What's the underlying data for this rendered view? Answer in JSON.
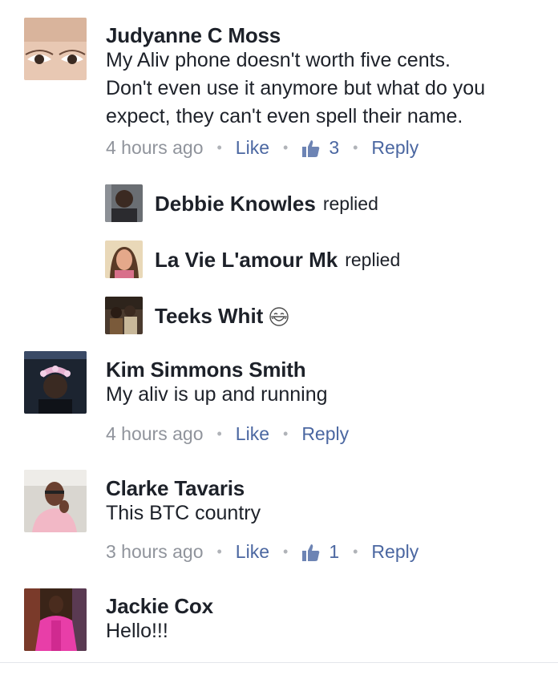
{
  "comments": [
    {
      "author": "Judyanne C Moss",
      "lines": [
        "My Aliv phone doesn't worth five cents.",
        "Don't even use it anymore but what do you",
        "expect, they can't even spell their name."
      ],
      "time": "4 hours ago",
      "like_label": "Like",
      "like_count": "3",
      "reply_label": "Reply",
      "replies": [
        {
          "name": "Debbie Knowles",
          "suffix": "replied"
        },
        {
          "name": "La Vie L'amour Mk",
          "suffix": "replied"
        },
        {
          "name": "Teeks Whit",
          "suffix": "",
          "emoji": "laughing-emoji"
        }
      ]
    },
    {
      "author": "Kim Simmons Smith",
      "lines": [
        "My aliv is up and running"
      ],
      "time": "4 hours ago",
      "like_label": "Like",
      "reply_label": "Reply"
    },
    {
      "author": "Clarke Tavaris",
      "lines": [
        "This BTC country"
      ],
      "time": "3 hours ago",
      "like_label": "Like",
      "like_count": "1",
      "reply_label": "Reply"
    },
    {
      "author": "Jackie Cox",
      "lines": [
        "Hello!!!"
      ]
    }
  ],
  "icons": {
    "like_count_icon": "thumbs-up-icon"
  },
  "colors": {
    "link": "#4b67a1",
    "meta": "#90949c",
    "text": "#1d2129"
  }
}
